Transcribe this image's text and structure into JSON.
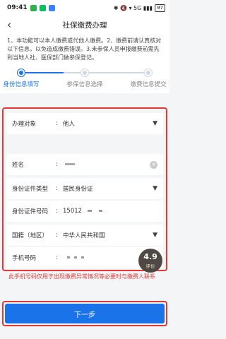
{
  "status_bar": {
    "time": "09:41",
    "right_info": "✱ 🔇 ▾ 5G ▮▮▮",
    "battery": "97"
  },
  "header": {
    "title": "社保缴费办理"
  },
  "notice": "1、本功能可以本人缴费或代他人缴费。2、缴费前请认真核对以下信息，以免造成缴费错误。3.未参保人员申报缴费前需先到当地人社、医保部门做参保登记。",
  "steps": [
    {
      "label": "身份信息填写",
      "active": true
    },
    {
      "label": "参保信息选择",
      "active": false
    },
    {
      "label": "缴费信息提交",
      "active": false
    }
  ],
  "form": {
    "payer": {
      "label": "办理对象",
      "value": "他人"
    },
    "name": {
      "label": "姓名",
      "value": ""
    },
    "id_type": {
      "label": "身份证件类型",
      "value": "居民身份证"
    },
    "id_number": {
      "label": "身份证件号码",
      "value": "15012"
    },
    "region": {
      "label": "国籍（地区）",
      "value": "中华人民共和国"
    },
    "phone": {
      "label": "手机号码",
      "value": ""
    }
  },
  "rating": {
    "score": "4.9",
    "label": "评价"
  },
  "hint": "此手机号码仅用于出现缴费异常情况等必要时与缴费人联系",
  "next_button": "下一步",
  "colors": {
    "accent": "#1a73e8",
    "highlight": "#e53935"
  }
}
